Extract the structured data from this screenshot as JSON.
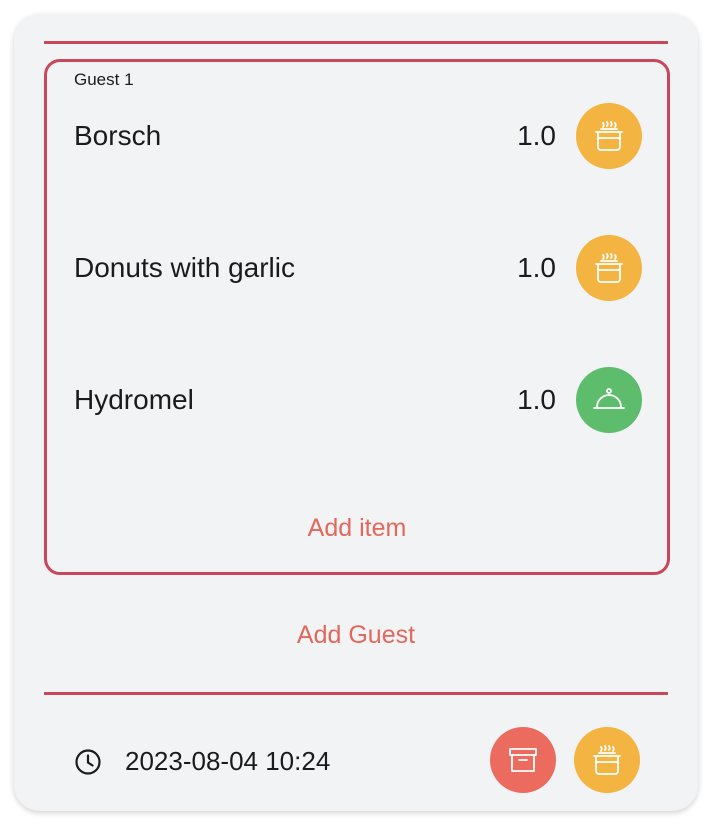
{
  "guest": {
    "title": "Guest 1",
    "items": [
      {
        "name": "Borsch",
        "quantity": "1.0",
        "status_icon": "cooking-pot-icon",
        "status_color": "#f3b441"
      },
      {
        "name": "Donuts with garlic",
        "quantity": "1.0",
        "status_icon": "cooking-pot-icon",
        "status_color": "#f3b441"
      },
      {
        "name": "Hydromel",
        "quantity": "1.0",
        "status_icon": "serving-cloche-icon",
        "status_color": "#5dbd6c"
      }
    ],
    "add_item_label": "Add item"
  },
  "add_guest_label": "Add Guest",
  "footer": {
    "timestamp": "2023-08-04 10:24",
    "archive_color": "#ec6b5f",
    "cooking_color": "#f3b441"
  },
  "colors": {
    "accent_line": "#c8475a",
    "action_text": "#e2685b",
    "card_background": "#f2f3f5"
  }
}
